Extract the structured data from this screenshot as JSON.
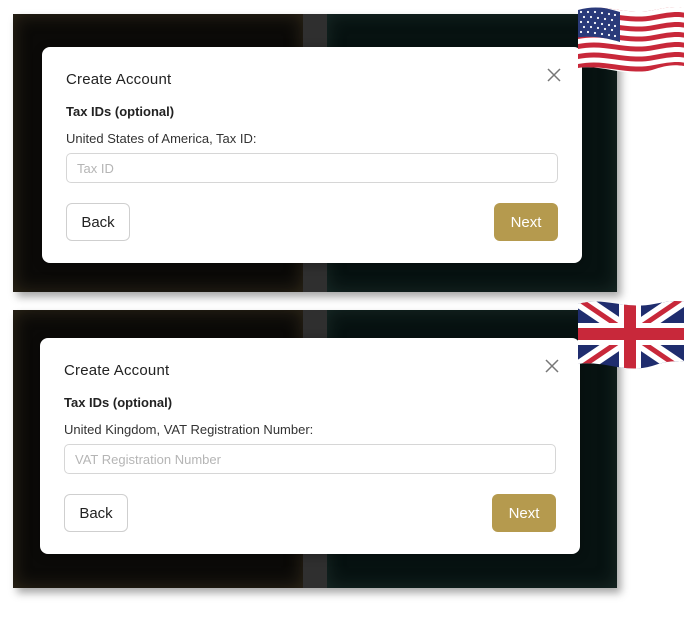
{
  "dialogs": [
    {
      "title": "Create Account",
      "section": "Tax IDs (optional)",
      "field_label": "United States of America, Tax ID:",
      "input_placeholder": "Tax ID",
      "back_label": "Back",
      "next_label": "Next",
      "flag_icon": "us-flag-icon"
    },
    {
      "title": "Create Account",
      "section": "Tax IDs (optional)",
      "field_label": "United Kingdom, VAT Registration Number:",
      "input_placeholder": "VAT Registration Number",
      "back_label": "Back",
      "next_label": "Next",
      "flag_icon": "uk-flag-icon"
    }
  ],
  "colors": {
    "next_button": "#b59a4e",
    "backdrop": "#2f2f2f"
  }
}
